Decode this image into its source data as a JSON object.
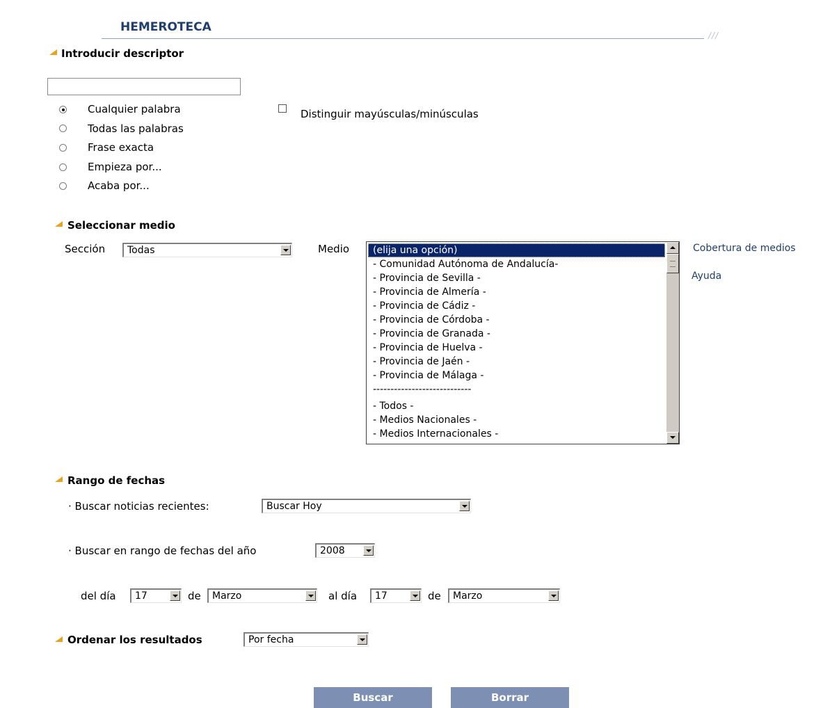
{
  "header": {
    "title": "HEMEROTECA",
    "slashes": "///"
  },
  "descriptor": {
    "heading": "Introducir descriptor",
    "input_value": "",
    "options": [
      {
        "label": "Cualquier palabra",
        "selected": true
      },
      {
        "label": "Todas las palabras",
        "selected": false
      },
      {
        "label": "Frase exacta",
        "selected": false
      },
      {
        "label": "Empieza por...",
        "selected": false
      },
      {
        "label": "Acaba por...",
        "selected": false
      }
    ],
    "case_label": "Distinguir mayúsculas/minúsculas",
    "case_checked": false
  },
  "medio": {
    "heading": "Seleccionar medio",
    "seccion_label": "Sección",
    "seccion_value": "Todas",
    "medio_label": "Medio",
    "list": [
      "(elija una opción)",
      "- Comunidad Autónoma de Andalucía-",
      "- Provincia de Sevilla -",
      "- Provincia de Almería -",
      "- Provincia de Cádiz -",
      "- Provincia de Córdoba -",
      "- Provincia de Granada -",
      "- Provincia de Huelva -",
      "- Provincia de Jaén -",
      "- Provincia de Málaga -",
      "----------------------------",
      "- Todos -",
      "- Medios Nacionales -",
      "- Medios Internacionales -"
    ],
    "selected_index": 0,
    "links": {
      "cobertura": "Cobertura de medios",
      "ayuda": "Ayuda"
    }
  },
  "fechas": {
    "heading": "Rango de fechas",
    "recientes_label": "· Buscar noticias recientes:",
    "recientes_value": "Buscar Hoy",
    "anio_label": "· Buscar en rango de fechas del año",
    "anio_value": "2008",
    "del_dia_label": "del día",
    "de_label_1": "de",
    "al_dia_label": "al día",
    "de_label_2": "de",
    "desde_dia": "17",
    "desde_mes": "Marzo",
    "hasta_dia": "17",
    "hasta_mes": "Marzo"
  },
  "orden": {
    "heading": "Ordenar los resultados",
    "value": "Por fecha"
  },
  "actions": {
    "buscar": "Buscar",
    "borrar": "Borrar"
  },
  "colors": {
    "accent": "#e8a21b",
    "title": "#1f3f6e",
    "button": "#7d8fb3",
    "list_selected": "#0a246a"
  }
}
